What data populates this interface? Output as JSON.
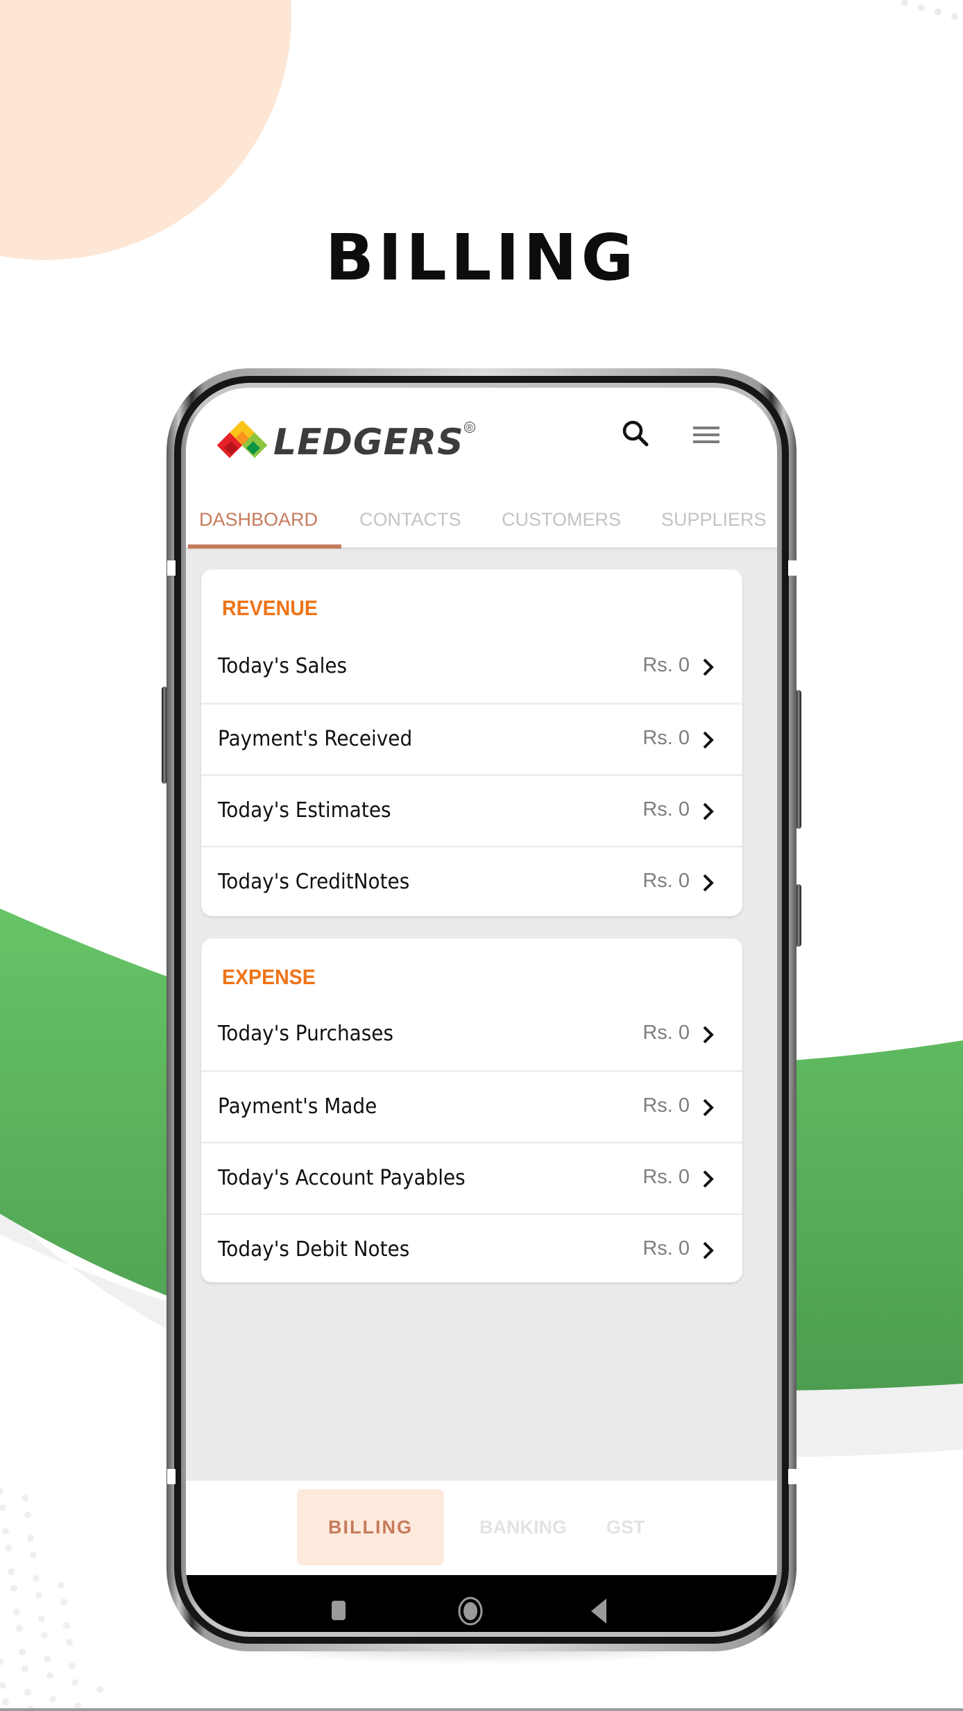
{
  "page": {
    "title": "BILLING"
  },
  "app": {
    "brand": "LEDGERS",
    "brand_mark": "®",
    "icons": {
      "search": "search-icon",
      "menu": "hamburger-menu-icon",
      "chevron": "chevron-right-icon"
    },
    "colors": {
      "accent": "#c67b5c",
      "section_title": "#ee7417",
      "active_nav_bg": "#fdeadd",
      "inactive_text": "#c3c3c3",
      "value_text": "#7d7d7d",
      "wave_green": "#5cb85c",
      "bg_circle": "#fde6d4"
    }
  },
  "tabs": [
    {
      "label": "DASHBOARD",
      "active": true
    },
    {
      "label": "CONTACTS",
      "active": false
    },
    {
      "label": "CUSTOMERS",
      "active": false
    },
    {
      "label": "SUPPLIERS",
      "active": false
    }
  ],
  "sections": [
    {
      "title": "REVENUE",
      "rows": [
        {
          "label": "Today's Sales",
          "value": "Rs. 0"
        },
        {
          "label": "Payment's Received",
          "value": "Rs. 0"
        },
        {
          "label": "Today's Estimates",
          "value": "Rs. 0"
        },
        {
          "label": "Today's CreditNotes",
          "value": "Rs. 0"
        }
      ]
    },
    {
      "title": "EXPENSE",
      "rows": [
        {
          "label": "Today's Purchases",
          "value": "Rs. 0"
        },
        {
          "label": "Payment's Made",
          "value": "Rs. 0"
        },
        {
          "label": "Today's Account Payables",
          "value": "Rs. 0"
        },
        {
          "label": "Today's Debit Notes",
          "value": "Rs. 0"
        }
      ]
    }
  ],
  "bottom_nav": [
    {
      "label": "BILLING",
      "active": true
    },
    {
      "label": "BANKING",
      "active": false
    },
    {
      "label": "GST",
      "active": false
    }
  ],
  "system_nav": {
    "recents": "recents-square-icon",
    "home": "home-circle-icon",
    "back": "back-triangle-icon"
  }
}
